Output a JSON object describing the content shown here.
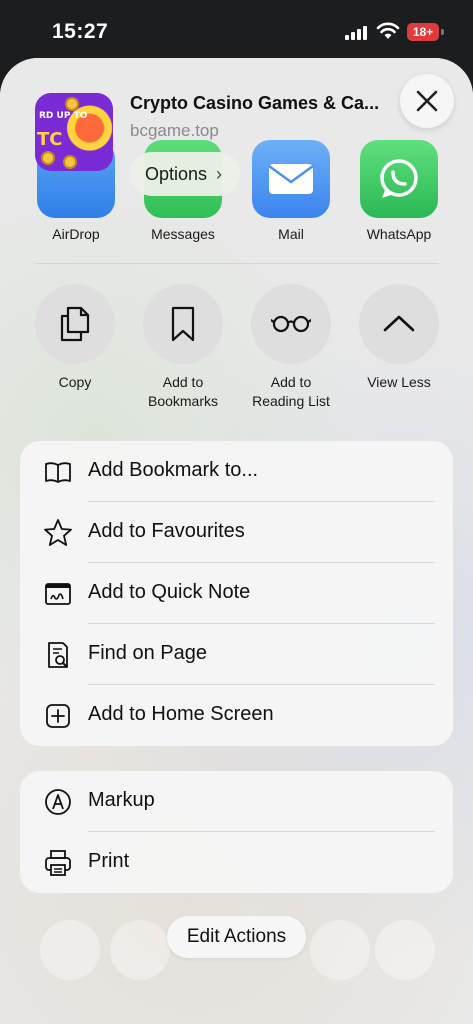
{
  "status_bar": {
    "time": "15:27",
    "battery_label": "18+"
  },
  "header": {
    "app_title": "Crypto Casino Games & Ca...",
    "app_url": "bcgame.top",
    "thumbnail_text_top": "RD UP TO",
    "thumbnail_text_big": "TC",
    "close_icon": "close-icon"
  },
  "share_targets": [
    {
      "label": "AirDrop",
      "icon": "airdrop-icon",
      "color": "#3d8ef0"
    },
    {
      "label": "Messages",
      "icon": "messages-icon",
      "color": "#35c759"
    },
    {
      "label": "Mail",
      "icon": "mail-icon",
      "color": "#3c8cf2"
    },
    {
      "label": "WhatsApp",
      "icon": "whatsapp-icon",
      "color": "#2fc561"
    }
  ],
  "options_button": {
    "label": "Options",
    "chevron": "›"
  },
  "actions": [
    {
      "label": "Copy",
      "icon": "copy-icon"
    },
    {
      "label": "Add to\nBookmarks",
      "icon": "bookmark-icon"
    },
    {
      "label": "Add to\nReading List",
      "icon": "glasses-icon"
    },
    {
      "label": "View Less",
      "icon": "chevron-up-icon"
    }
  ],
  "menu_primary": [
    {
      "label": "Add Bookmark to...",
      "icon": "book-icon"
    },
    {
      "label": "Add to Favourites",
      "icon": "star-icon"
    },
    {
      "label": "Add to Quick Note",
      "icon": "quick-note-icon"
    },
    {
      "label": "Find on Page",
      "icon": "find-page-icon"
    },
    {
      "label": "Add to Home Screen",
      "icon": "add-square-icon"
    }
  ],
  "menu_secondary": [
    {
      "label": "Markup",
      "icon": "markup-icon"
    },
    {
      "label": "Print",
      "icon": "printer-icon"
    }
  ],
  "edit_actions_label": "Edit Actions"
}
